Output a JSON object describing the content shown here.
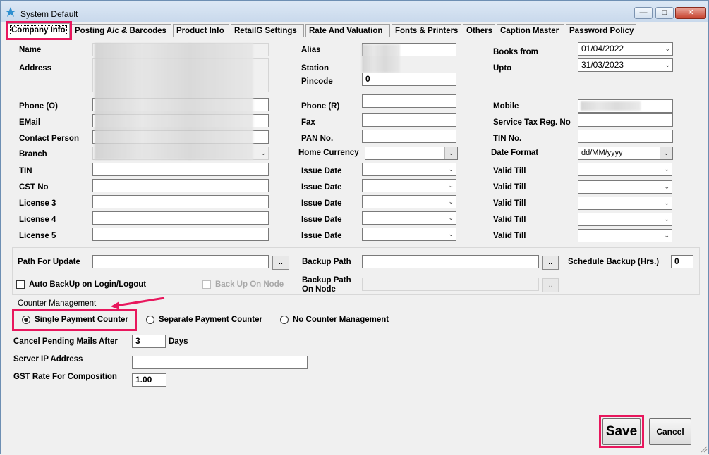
{
  "window": {
    "title": "System Default"
  },
  "tabs": [
    "Company Info",
    "Posting A/c & Barcodes",
    "Product Info",
    "RetailG Settings",
    "Rate And Valuation",
    "Fonts & Printers",
    "Others",
    "Caption Master",
    "Password Policy"
  ],
  "company": {
    "name_label": "Name",
    "address_label": "Address",
    "phone_o_label": "Phone (O)",
    "email_label": "EMail",
    "contact_person_label": "Contact Person",
    "branch_label": "Branch",
    "tin_label": "TIN",
    "cst_label": "CST No",
    "license3_label": "License 3",
    "license4_label": "License 4",
    "license5_label": "License 5"
  },
  "middle": {
    "alias_label": "Alias",
    "station_label": "Station",
    "pincode_label": "Pincode",
    "pincode_value": "0",
    "phone_r_label": "Phone (R)",
    "fax_label": "Fax",
    "pan_label": "PAN No.",
    "home_currency_label": "Home Currency",
    "issue_date_label": "Issue Date"
  },
  "right": {
    "books_from_label": "Books from",
    "books_from_value": "01/04/2022",
    "upto_label": "Upto",
    "upto_value": "31/03/2023",
    "mobile_label": "Mobile",
    "service_tax_label": "Service Tax Reg. No",
    "tin_no_label": "TIN No.",
    "date_format_label": "Date Format",
    "date_format_value": "dd/MM/yyyy",
    "valid_till_label": "Valid Till"
  },
  "backup": {
    "path_update_label": "Path For Update",
    "backup_path_label": "Backup Path",
    "schedule_label": "Schedule Backup (Hrs.)",
    "schedule_value": "0",
    "auto_backup_label": "Auto BackUp on Login/Logout",
    "backup_on_node_label": "Back Up On Node",
    "backup_path_node_label1": "Backup Path",
    "backup_path_node_label2": "On Node",
    "browse_label": ".."
  },
  "counter": {
    "group_label": "Counter Management",
    "single_label": "Single Payment Counter",
    "separate_label": "Separate Payment Counter",
    "none_label": "No Counter Management",
    "selected": "single"
  },
  "misc": {
    "cancel_mails_label": "Cancel Pending Mails After",
    "cancel_mails_value": "3",
    "days_label": "Days",
    "server_ip_label": "Server IP Address",
    "gst_rate_label": "GST Rate For Composition",
    "gst_rate_value": "1.00"
  },
  "footer": {
    "save_label": "Save",
    "cancel_label": "Cancel"
  },
  "colors": {
    "highlight": "#e8175d",
    "titlebar": "#c9d9ec"
  }
}
